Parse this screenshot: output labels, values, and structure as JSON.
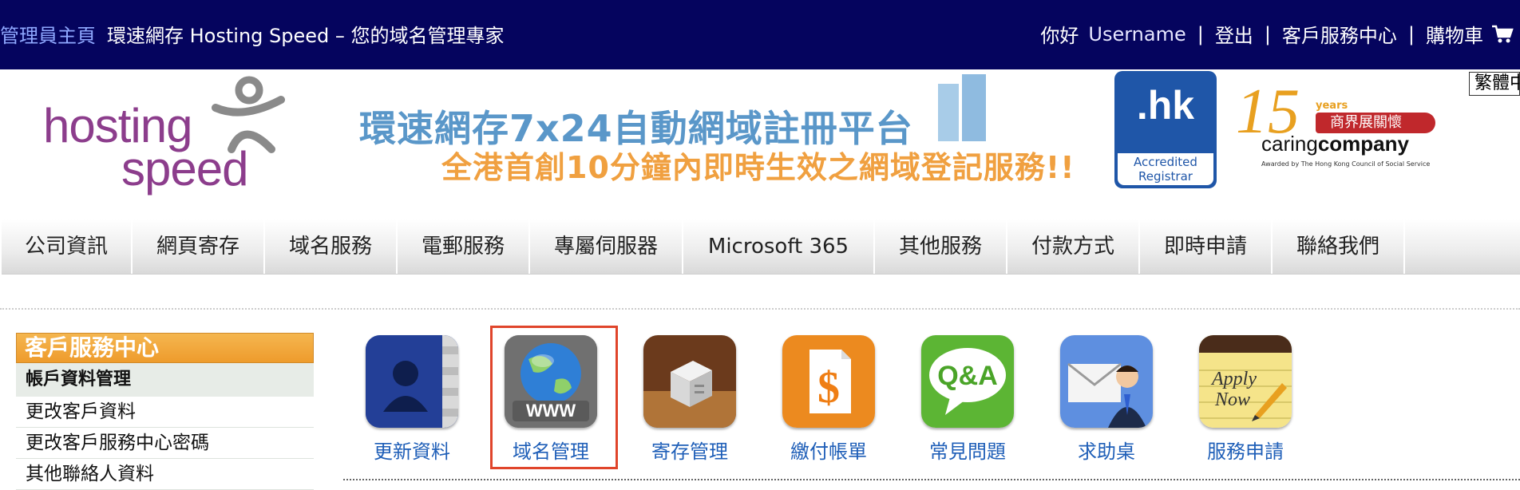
{
  "topbar": {
    "admin_link": "管理員主頁",
    "site_title": "環速網存 Hosting Speed – 您的域名管理專家",
    "greeting": "你好",
    "username": "Username",
    "sep": "|",
    "logout": "登出",
    "customer_center": "客戶服務中心",
    "cart": "購物車",
    "cart_icon": "shopping-cart-icon"
  },
  "language_button": "繁體中",
  "header": {
    "logo_line1": "hosting",
    "logo_line2": "speed",
    "banner_line1": "環速網存7x24自動網域註冊平台",
    "banner_line2": "全港首創10分鐘內即時生效之網域登記服務!!",
    "hk_badge_text": ".hk",
    "hk_badge_sub1": "Accredited",
    "hk_badge_sub2": "Registrar",
    "caring_15": "15",
    "caring_years": "years",
    "caring_red": "商界展關懷",
    "caring_text_a": "caring",
    "caring_text_b": "company",
    "caring_small": "Awarded by The Hong Kong Council of Social Service"
  },
  "nav": {
    "items": [
      "公司資訊",
      "網頁寄存",
      "域名服務",
      "電郵服務",
      "專屬伺服器",
      "Microsoft 365",
      "其他服務",
      "付款方式",
      "即時申請",
      "聯絡我們"
    ]
  },
  "sidebar": {
    "title": "客戶服務中心",
    "section": "帳戶資料管理",
    "links": [
      "更改客戶資料",
      "更改客戶服務中心密碼",
      "其他聯絡人資料"
    ]
  },
  "icons": [
    {
      "label": "更新資料",
      "icon": "contacts-icon",
      "selected": false
    },
    {
      "label": "域名管理",
      "icon": "globe-www-icon",
      "selected": true
    },
    {
      "label": "寄存管理",
      "icon": "storage-box-icon",
      "selected": false
    },
    {
      "label": "繳付帳單",
      "icon": "invoice-dollar-icon",
      "selected": false
    },
    {
      "label": "常見問題",
      "icon": "qa-bubble-icon",
      "selected": false
    },
    {
      "label": "求助桌",
      "icon": "helpdesk-mail-icon",
      "selected": false
    },
    {
      "label": "服務申請",
      "icon": "apply-now-notepad-icon",
      "selected": false
    }
  ],
  "colors": {
    "topbar_bg": "#05045e",
    "sidebar_title_bg": "#ee9b2c",
    "icon_label": "#1f5fb8",
    "selected_border": "#e0452b"
  }
}
